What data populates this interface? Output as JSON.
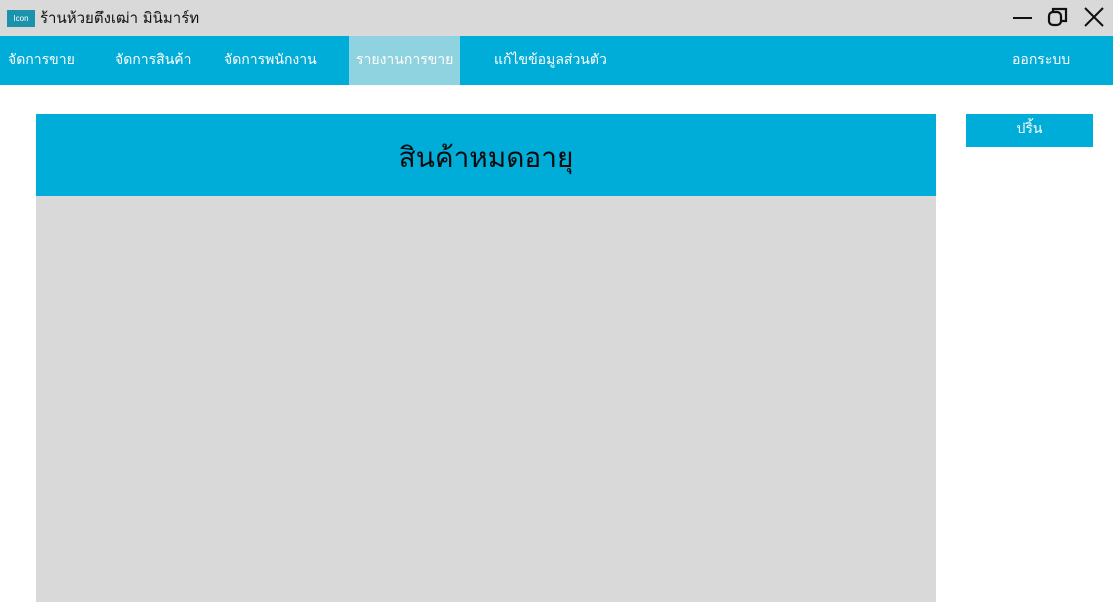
{
  "window": {
    "icon_label": "Icon",
    "title": "ร้านห้วยตึงเฒ่า มินิมาร์ท",
    "minimize_icon": "minimize-icon",
    "restore_icon": "restore-icon",
    "close_icon": "close-icon"
  },
  "menu": {
    "items": [
      {
        "label": "จัดการขาย"
      },
      {
        "label": "จัดการสินค้า"
      },
      {
        "label": "จัดการพนักงาน"
      },
      {
        "label": "รายงานการขาย",
        "active": true
      },
      {
        "label": "แก้ไขข้อมูลส่วนตัว"
      }
    ],
    "logout_label": "ออกระบบ"
  },
  "main": {
    "panel_title": "สินค้าหมดอายุ",
    "print_label": "ปริ้น"
  },
  "colors": {
    "accent": "#00acd8",
    "active_tab": "#8fd2e0",
    "gray": "#d9d9d9",
    "icon_bg": "#1b93ad"
  }
}
